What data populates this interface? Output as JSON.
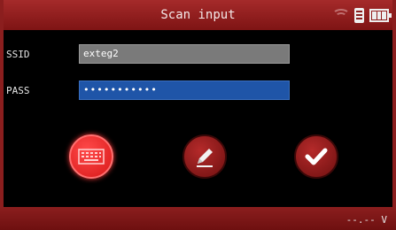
{
  "header": {
    "title": "Scan input"
  },
  "fields": {
    "ssid_label": "SSID",
    "ssid_value": "exteg2",
    "pass_label": "PASS",
    "pass_value": "•••••••••••"
  },
  "footer": {
    "voltage": "--.-- V"
  },
  "icons": {
    "keyboard": "keyboard-icon",
    "edit": "pencil-icon",
    "confirm": "checkmark-icon"
  },
  "colors": {
    "accent": "#8b1e1e",
    "active_button": "#e02020",
    "pass_field": "#1f55a8"
  }
}
